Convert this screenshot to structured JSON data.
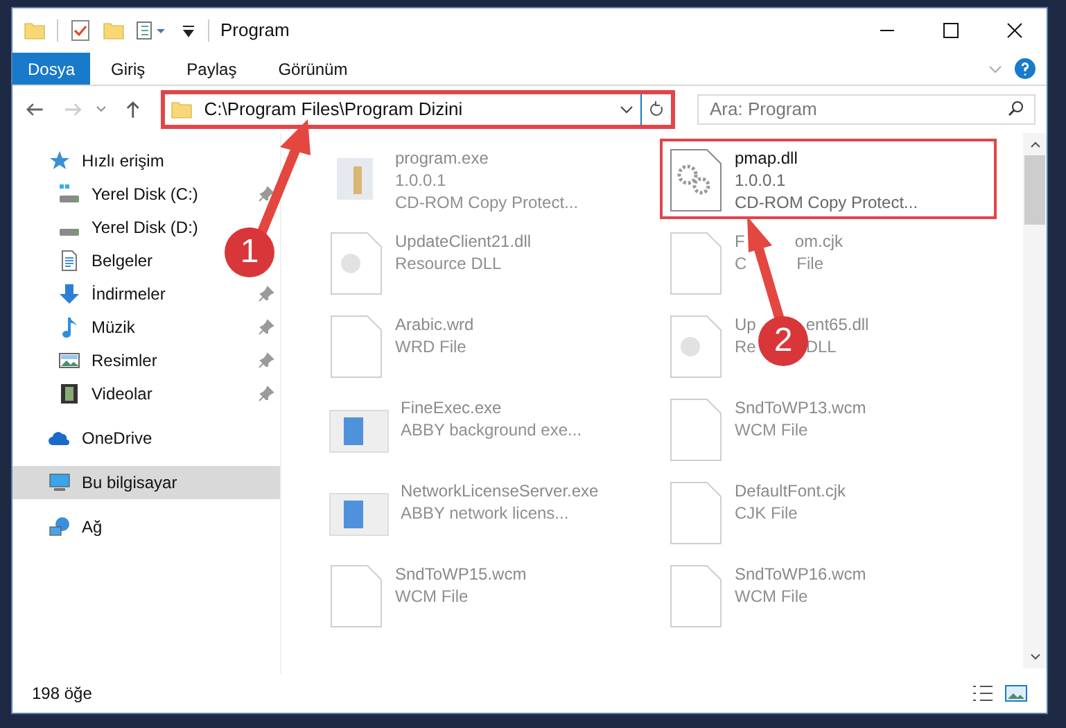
{
  "window": {
    "title": "Program"
  },
  "ribbon_tabs": [
    {
      "label": "Dosya",
      "selected": true
    },
    {
      "label": "Giriş",
      "selected": false
    },
    {
      "label": "Paylaş",
      "selected": false
    },
    {
      "label": "Görünüm",
      "selected": false
    }
  ],
  "address": {
    "path": "C:\\Program Files\\Program Dizini",
    "highlighted": true
  },
  "search": {
    "placeholder": "Ara: Program"
  },
  "nav": [
    {
      "label": "Hızlı erişim",
      "kind": "star",
      "selected": false,
      "children": [
        {
          "label": "Yerel Disk (C:)",
          "kind": "drive-c",
          "pinned": true,
          "selected": false
        },
        {
          "label": "Yerel Disk (D:)",
          "kind": "drive",
          "pinned": false,
          "selected": false
        },
        {
          "label": "Belgeler",
          "kind": "docs",
          "pinned": false,
          "selected": false
        },
        {
          "label": "İndirmeler",
          "kind": "download",
          "pinned": true,
          "selected": false
        },
        {
          "label": "Müzik",
          "kind": "music",
          "pinned": true,
          "selected": false
        },
        {
          "label": "Resimler",
          "kind": "pictures",
          "pinned": true,
          "selected": false
        },
        {
          "label": "Videolar",
          "kind": "video",
          "pinned": true,
          "selected": false
        }
      ]
    },
    {
      "label": "OneDrive",
      "kind": "cloud",
      "selected": false
    },
    {
      "label": "Bu bilgisayar",
      "kind": "pc",
      "selected": true
    },
    {
      "label": "Ağ",
      "kind": "network",
      "selected": false
    }
  ],
  "files": [
    {
      "name": [
        "program.exe"
      ],
      "lines": [
        [
          "1.0.0.1"
        ],
        [
          "CD-ROM Copy Protect..."
        ]
      ],
      "kind": "setup",
      "highlighted": false
    },
    {
      "name": [
        "pmap.dll"
      ],
      "lines": [
        [
          "1.0.0.1"
        ],
        [
          "CD-ROM Copy Protect..."
        ]
      ],
      "kind": "dll",
      "highlighted": true
    },
    {
      "name": [
        "UpdateClient21.dll"
      ],
      "lines": [
        [
          "Resource DLL"
        ]
      ],
      "kind": "dll-plain",
      "highlighted": false
    },
    {
      "name": [
        "F",
        "om.cjk"
      ],
      "lines": [
        [
          "C",
          "File"
        ]
      ],
      "kind": "blank",
      "highlighted": false
    },
    {
      "name": [
        "Arabic.wrd"
      ],
      "lines": [
        [
          "WRD File"
        ]
      ],
      "kind": "blank",
      "highlighted": false
    },
    {
      "name": [
        "Up",
        "ent65.dll"
      ],
      "lines": [
        [
          "Re",
          "DLL"
        ]
      ],
      "kind": "dll-plain",
      "highlighted": false
    },
    {
      "name": [
        "FineExec.exe"
      ],
      "lines": [
        [
          "ABBY background exe..."
        ]
      ],
      "kind": "app",
      "highlighted": false
    },
    {
      "name": [
        "SndToWP13.wcm"
      ],
      "lines": [
        [
          "WCM File"
        ]
      ],
      "kind": "blank",
      "highlighted": false
    },
    {
      "name": [
        "NetworkLicenseServer.exe"
      ],
      "lines": [
        [
          "ABBY network licens..."
        ]
      ],
      "kind": "app",
      "highlighted": false
    },
    {
      "name": [
        "DefaultFont.cjk"
      ],
      "lines": [
        [
          "CJK File"
        ]
      ],
      "kind": "blank",
      "highlighted": false
    },
    {
      "name": [
        "SndToWP15.wcm"
      ],
      "lines": [
        [
          "WCM File"
        ]
      ],
      "kind": "blank",
      "highlighted": false
    },
    {
      "name": [
        "SndToWP16.wcm"
      ],
      "lines": [
        [
          "WCM File"
        ]
      ],
      "kind": "blank",
      "highlighted": false
    }
  ],
  "status_bar": {
    "count": "198 öğe"
  },
  "annotations": [
    {
      "label": "1"
    },
    {
      "label": "2"
    }
  ]
}
